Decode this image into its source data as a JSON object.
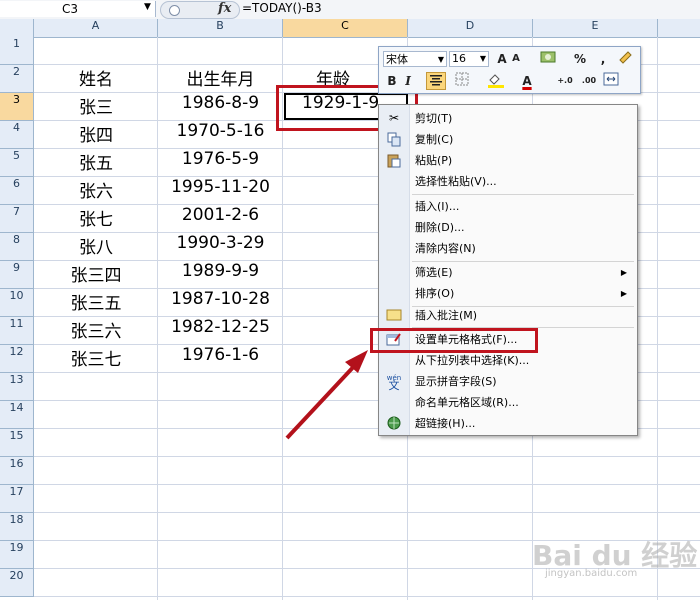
{
  "formula_bar": {
    "name_box": "C3",
    "fx_label": "fx",
    "formula": "=TODAY()-B3"
  },
  "columns": [
    "A",
    "B",
    "C",
    "D",
    "E"
  ],
  "rows": [
    "1",
    "2",
    "3",
    "4",
    "5",
    "6",
    "7",
    "8",
    "9",
    "10",
    "11",
    "12",
    "13",
    "14",
    "15",
    "16",
    "17",
    "18",
    "19",
    "20"
  ],
  "sheet": {
    "headers": {
      "name": "姓名",
      "birth": "出生年月",
      "age": "年龄"
    },
    "records": [
      {
        "name": "张三",
        "birth": "1986-8-9"
      },
      {
        "name": "张四",
        "birth": "1970-5-16"
      },
      {
        "name": "张五",
        "birth": "1976-5-9"
      },
      {
        "name": "张六",
        "birth": "1995-11-20"
      },
      {
        "name": "张七",
        "birth": "2001-2-6"
      },
      {
        "name": "张八",
        "birth": "1990-3-29"
      },
      {
        "name": "张三四",
        "birth": "1989-9-9"
      },
      {
        "name": "张三五",
        "birth": "1987-10-28"
      },
      {
        "name": "张三六",
        "birth": "1982-12-25"
      },
      {
        "name": "张三七",
        "birth": "1976-1-6"
      }
    ],
    "c3_value": "1929-1-9"
  },
  "mini_toolbar": {
    "font": "宋体",
    "size": "16",
    "grow": "A",
    "shrink": "A",
    "percent": "%",
    "comma": ",",
    "bold": "B",
    "italic": "I",
    "font_color": "A",
    "dec_inc": "+.0",
    "dec_dec": ".00"
  },
  "context_menu": {
    "cut": "剪切(T)",
    "copy": "复制(C)",
    "paste": "粘贴(P)",
    "paste_special": "选择性粘贴(V)...",
    "insert": "插入(I)...",
    "delete": "删除(D)...",
    "clear": "清除内容(N)",
    "filter": "筛选(E)",
    "sort": "排序(O)",
    "insert_comment": "插入批注(M)",
    "format_cells": "设置单元格格式(F)...",
    "pick_from_list": "从下拉列表中选择(K)...",
    "phonetic": "显示拼音字段(S)",
    "define_name": "命名单元格区域(R)...",
    "hyperlink": "超链接(H)...",
    "phonetic_icon_text": "wén"
  },
  "colors": {
    "highlight_red": "#c0141e",
    "header_bg": "#e4ecf7",
    "active_header": "#f9d99f"
  },
  "watermark": {
    "main": "Bai du 经验",
    "sub": "jingyan.baidu.com"
  }
}
